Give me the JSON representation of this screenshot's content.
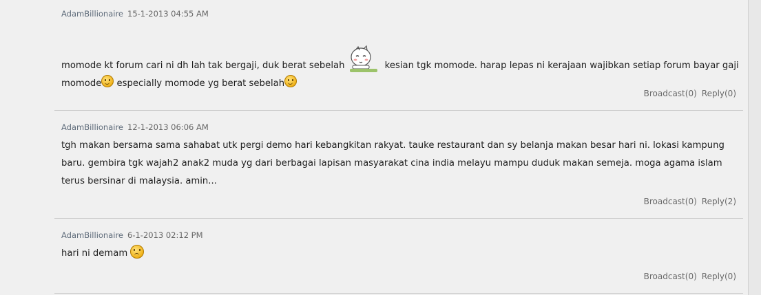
{
  "posts": [
    {
      "author": "AdamBillionaire",
      "time": "15-1-2013 04:55 AM",
      "segments": {
        "a": "momode kt forum cari ni dh lah tak bergaji, duk berat sebelah",
        "b": " kesian tgk momode. harap lepas ni kerajaan wajibkan setiap forum bayar gaji momode",
        "c": " especially momode yg berat sebelah"
      },
      "broadcast": "Broadcast(0)",
      "reply": "Reply(0)"
    },
    {
      "author": "AdamBillionaire",
      "time": "12-1-2013 06:06 AM",
      "text": "tgh makan bersama sama sahabat utk pergi demo hari kebangkitan rakyat. tauke restaurant dan sy belanja makan besar hari ni. lokasi kampung baru. gembira tgk wajah2 anak2 muda yg dari berbagai lapisan masyarakat cina india melayu mampu duduk makan semeja. moga agama islam terus bersinar di malaysia. amin...",
      "broadcast": "Broadcast(0)",
      "reply": "Reply(2)"
    },
    {
      "author": "AdamBillionaire",
      "time": "6-1-2013 02:12 PM",
      "text": "hari ni demam",
      "broadcast": "Broadcast(0)",
      "reply": "Reply(0)"
    }
  ],
  "icons": [
    "mascot-emoticon",
    "smile-emoticon",
    "laugh-emoticon",
    "sad-emoticon"
  ]
}
